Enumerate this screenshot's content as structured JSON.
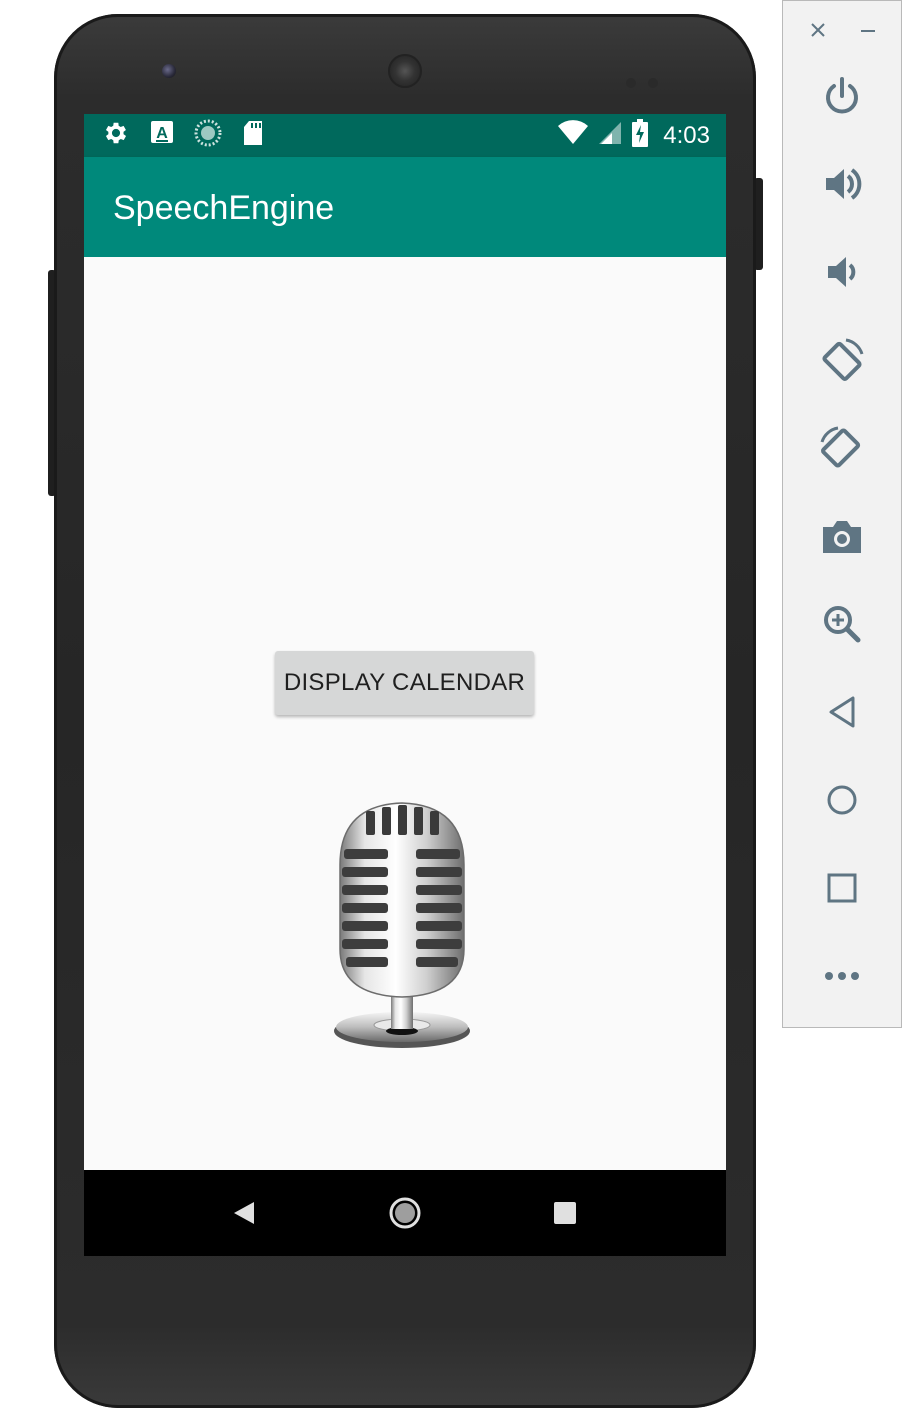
{
  "status_bar": {
    "time": "4:03",
    "left_icons": [
      "settings-icon",
      "keyboard-a-icon",
      "sync-circle-icon",
      "sd-card-icon"
    ],
    "right_icons": [
      "wifi-icon",
      "cell-signal-icon",
      "battery-charging-icon"
    ]
  },
  "app": {
    "title": "SpeechEngine",
    "display_calendar_label": "DISPLAY CALENDAR",
    "image": "microphone-image"
  },
  "nav": [
    "back-icon",
    "home-icon",
    "recents-icon"
  ],
  "emulator_panel": {
    "controls": [
      "close-icon",
      "minimize-icon",
      "power-icon",
      "volume-up-icon",
      "volume-down-icon",
      "rotate-left-icon",
      "rotate-right-icon",
      "camera-icon",
      "zoom-icon",
      "back-icon",
      "home-icon",
      "overview-icon",
      "more-icon"
    ]
  },
  "colors": {
    "status_bar": "#00695c",
    "app_bar": "#00897b",
    "background": "#fafafa",
    "button": "#d6d7d7",
    "panel_icon": "#5f7583"
  }
}
